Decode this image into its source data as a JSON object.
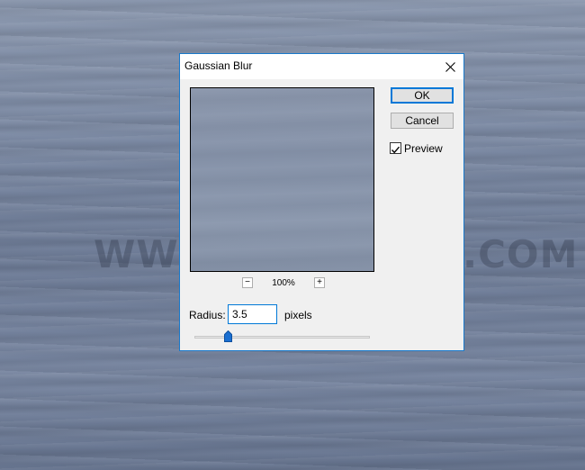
{
  "watermark": "WWW.PSD-DUDE.COM",
  "dialog": {
    "title": "Gaussian Blur",
    "buttons": {
      "ok": "OK",
      "cancel": "Cancel"
    },
    "preview": {
      "label": "Preview",
      "checked": true
    },
    "zoom": {
      "minus": "−",
      "level": "100%",
      "plus": "+"
    },
    "radius": {
      "label": "Radius:",
      "value": "3.5",
      "unit": "pixels"
    },
    "slider": {
      "position_fraction": 0.19
    }
  },
  "colors": {
    "accent": "#0078d7",
    "thumb": "#1a6fd1"
  },
  "icons": {
    "close": "close-icon",
    "check": "checkmark-icon"
  }
}
